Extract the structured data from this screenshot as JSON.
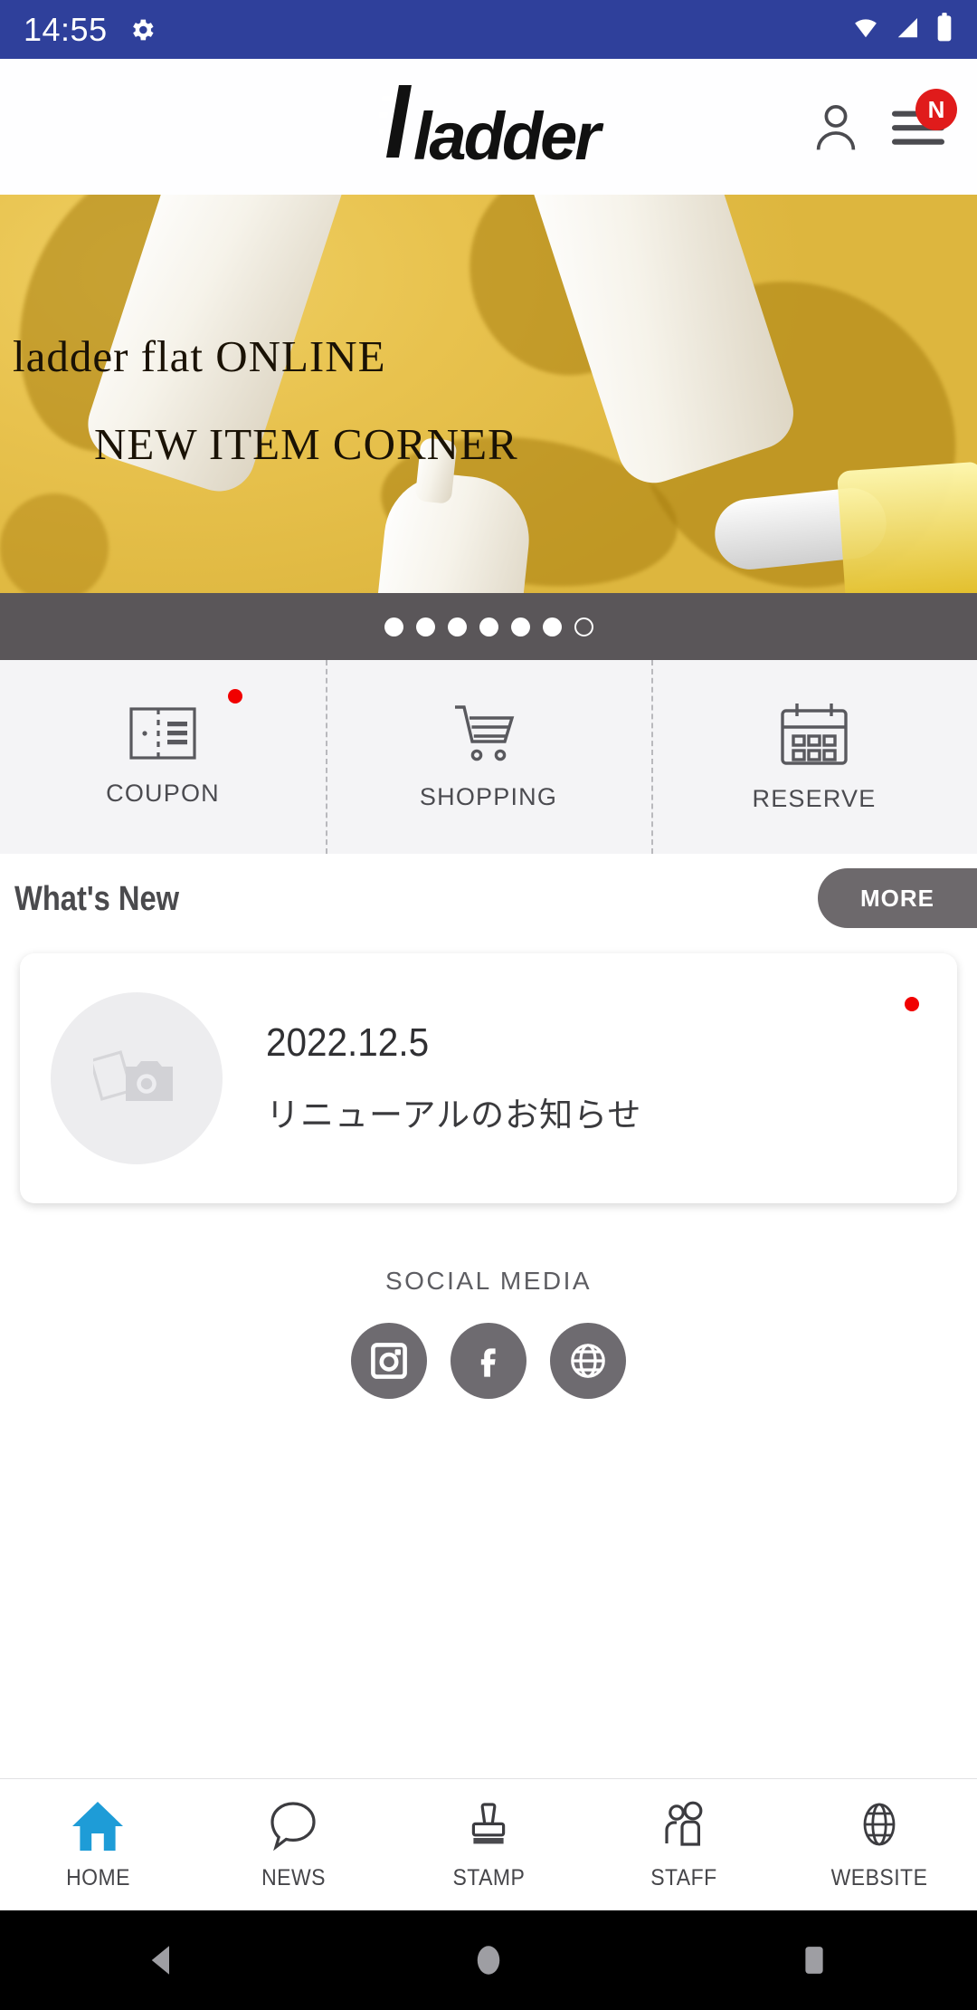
{
  "status_bar": {
    "time": "14:55",
    "gear_icon": "gear-icon",
    "wifi_icon": "wifi-icon",
    "signal_icon": "signal-icon",
    "battery_icon": "battery-icon",
    "background_color": "#2F409B"
  },
  "header": {
    "logo_text": "ladder",
    "account_icon": "person-icon",
    "menu_icon": "hamburger-menu-icon",
    "menu_badge": "N",
    "badge_color": "#E01B1B"
  },
  "hero": {
    "line1": "ladder flat ONLINE",
    "line2": "NEW ITEM CORNER",
    "background_color": "#E5C04C"
  },
  "carousel": {
    "total_dots": 7,
    "active_index": 6,
    "bar_color": "#5A5659"
  },
  "quick_actions": [
    {
      "label": "COUPON",
      "icon": "coupon-icon",
      "badge": true
    },
    {
      "label": "SHOPPING",
      "icon": "cart-icon",
      "badge": false
    },
    {
      "label": "RESERVE",
      "icon": "calendar-icon",
      "badge": false
    }
  ],
  "whats_new": {
    "title": "What's New",
    "more_label": "MORE",
    "more_color": "#6D696C",
    "items": [
      {
        "date": "2022.12.5",
        "title": "リニューアルのお知らせ",
        "thumb_icon": "photo-placeholder-icon",
        "unread": true
      }
    ]
  },
  "social": {
    "title": "SOCIAL MEDIA",
    "links": [
      {
        "name": "instagram",
        "icon": "instagram-icon"
      },
      {
        "name": "facebook",
        "icon": "facebook-icon"
      },
      {
        "name": "website",
        "icon": "globe-icon"
      }
    ],
    "circle_color": "#6E6B70"
  },
  "bottom_nav": {
    "active_color": "#1E9CD7",
    "items": [
      {
        "label": "HOME",
        "icon": "home-icon",
        "active": true
      },
      {
        "label": "NEWS",
        "icon": "chat-bubble-icon",
        "active": false
      },
      {
        "label": "STAMP",
        "icon": "stamp-icon",
        "active": false
      },
      {
        "label": "STAFF",
        "icon": "people-icon",
        "active": false
      },
      {
        "label": "WEBSITE",
        "icon": "globe-icon",
        "active": false
      }
    ]
  },
  "android_nav": {
    "back_icon": "back-triangle-icon",
    "home_icon": "home-circle-icon",
    "recents_icon": "recents-square-icon"
  }
}
